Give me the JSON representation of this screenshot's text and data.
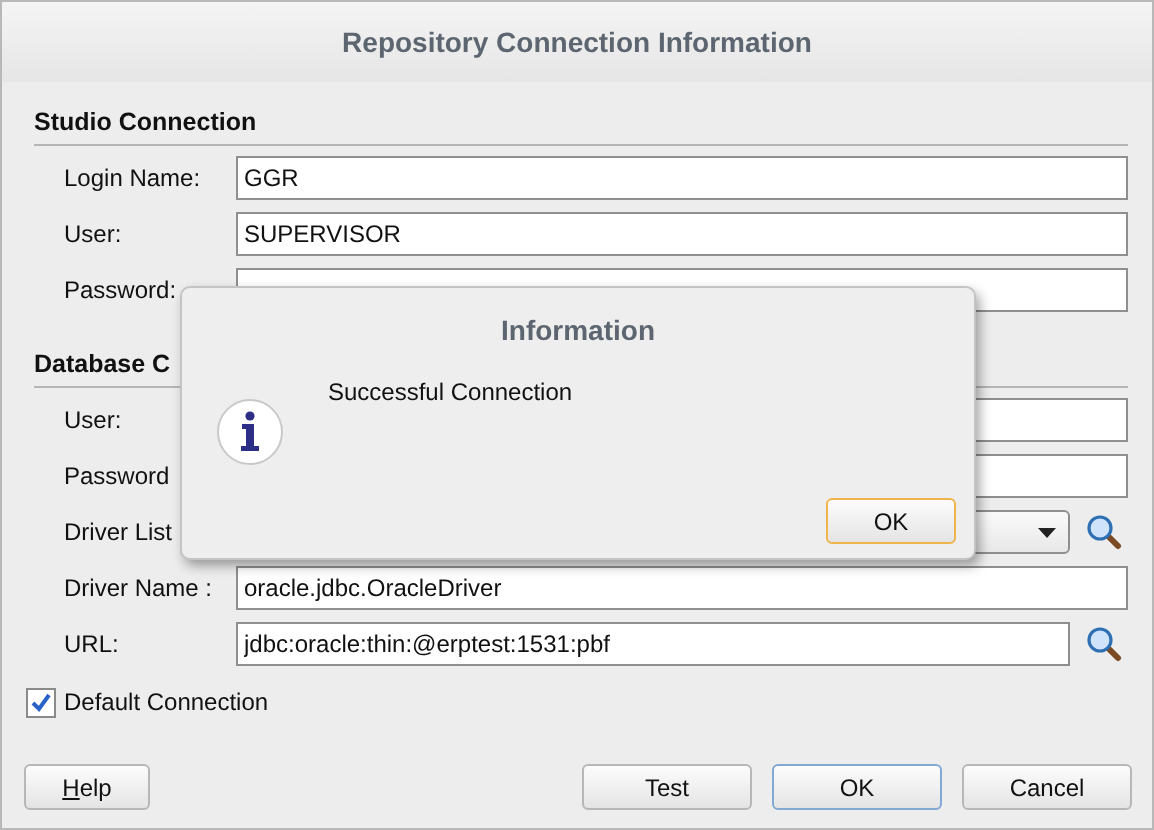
{
  "window": {
    "title": "Repository Connection Information"
  },
  "sections": [
    {
      "heading": "Studio Connection",
      "fields": [
        {
          "label": "Login Name:",
          "value": "GGR",
          "kind": "text"
        },
        {
          "label": "User:",
          "value": "SUPERVISOR",
          "kind": "text"
        },
        {
          "label": "Password:",
          "kind": "text"
        }
      ]
    },
    {
      "heading": "Database C",
      "fields": [
        {
          "label": "User:",
          "kind": "text"
        },
        {
          "label": "Password",
          "kind": "text"
        },
        {
          "label": "Driver List",
          "kind": "dropdown"
        },
        {
          "label": "Driver Name :",
          "value": "oracle.jdbc.OracleDriver",
          "kind": "text"
        },
        {
          "label": "URL:",
          "value": "jdbc:oracle:thin:@erptest:1531:pbf",
          "kind": "lookup"
        }
      ]
    }
  ],
  "default_connection": {
    "label": "Default Connection",
    "checked": true
  },
  "buttons": [
    {
      "label": "Help",
      "mnemonic": true,
      "default": false
    },
    {
      "label": "Test",
      "mnemonic": false,
      "default": false
    },
    {
      "label": "OK",
      "mnemonic": false,
      "default": true
    },
    {
      "label": "Cancel",
      "mnemonic": false,
      "default": false
    }
  ],
  "message_dialog": {
    "title": "Information",
    "message": "Successful Connection",
    "buttons": [
      {
        "label": "OK",
        "focused": true
      }
    ]
  }
}
